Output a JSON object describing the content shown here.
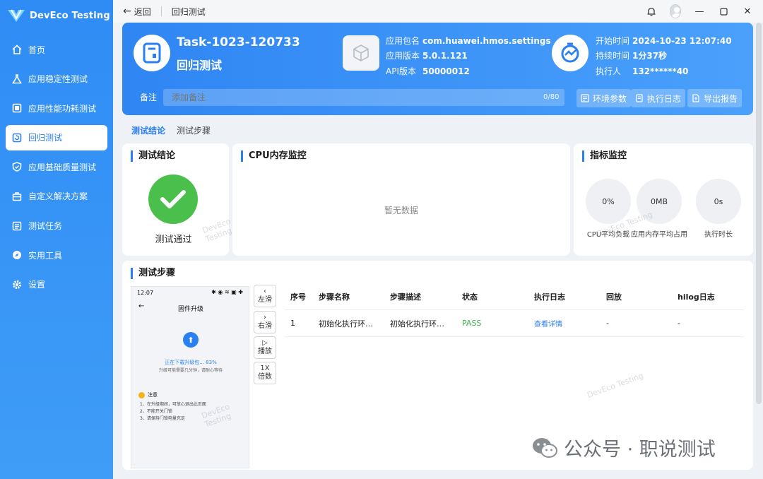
{
  "app": {
    "name": "DevEco Testing"
  },
  "colors": {
    "accent": "#2a7ff2",
    "sidebar": "#3592f6",
    "pass": "#3fb34f",
    "success_circle": "#4bbf4b"
  },
  "sidebar": {
    "items": [
      {
        "label": "首页",
        "icon": "home-icon"
      },
      {
        "label": "应用稳定性测试",
        "icon": "flask-icon"
      },
      {
        "label": "应用性能功耗测试",
        "icon": "performance-icon"
      },
      {
        "label": "回归测试",
        "icon": "regression-icon",
        "active": true
      },
      {
        "label": "应用基础质量测试",
        "icon": "shield-check-icon"
      },
      {
        "label": "自定义解决方案",
        "icon": "toolbox-icon"
      },
      {
        "label": "测试任务",
        "icon": "list-icon"
      },
      {
        "label": "实用工具",
        "icon": "compass-icon"
      },
      {
        "label": "设置",
        "icon": "gear-icon"
      }
    ]
  },
  "topbar": {
    "back_label": "返回",
    "breadcrumb": "回归测试"
  },
  "task": {
    "id": "Task-1023-120733",
    "type": "回归测试",
    "package_label": "应用包名",
    "package": "com.huawei.hmos.settings",
    "version_label": "应用版本",
    "version": "5.0.1.121",
    "api_label": "API版本",
    "api": "50000012",
    "start_label": "开始时间",
    "start": "2024-10-23 12:07:40",
    "duration_label": "持续时间",
    "duration": "1分37秒",
    "executor_label": "执行人",
    "executor": "132******40",
    "remark_label": "备注",
    "remark_placeholder": "添加备注",
    "remark_count": "0/80"
  },
  "header_buttons": {
    "env": "环境参数",
    "log": "执行日志",
    "export": "导出报告"
  },
  "tabs": [
    {
      "label": "测试结论",
      "active": true
    },
    {
      "label": "测试步骤"
    }
  ],
  "result": {
    "title": "测试结论",
    "text": "测试通过"
  },
  "cpu": {
    "title": "CPU内存监控",
    "empty": "暂无数据"
  },
  "metrics": {
    "title": "指标监控",
    "items": [
      {
        "value": "0%",
        "label": "CPU平均负载"
      },
      {
        "value": "0MB",
        "label": "应用内存平均占用"
      },
      {
        "value": "0s",
        "label": "执行时长"
      }
    ]
  },
  "steps": {
    "title": "测试步骤",
    "phone": {
      "time": "12:07",
      "title": "固件升级",
      "progress": "正在下载升级包... 83%",
      "sub": "升级可能需要几分钟，请耐心等待",
      "note": "注意",
      "list": [
        "1、在升级期间，可放心退出此页面",
        "2、不能开关门锁",
        "3、请保持门锁电量充足"
      ]
    },
    "controls": [
      {
        "icon": "‹",
        "label": "左滑"
      },
      {
        "icon": "›",
        "label": "右滑"
      },
      {
        "icon": "▷",
        "label": "播放"
      },
      {
        "icon": "1X",
        "label": "倍数"
      }
    ],
    "columns": [
      "序号",
      "步骤名称",
      "步骤描述",
      "状态",
      "执行日志",
      "回放",
      "hilog日志"
    ],
    "rows": [
      {
        "no": "1",
        "name": "初始化执行环…",
        "desc": "初始化执行环…",
        "status": "PASS",
        "log": "查看详情",
        "replay": "-",
        "hilog": "-"
      }
    ]
  },
  "watermark": "DevEco Testing",
  "footer": {
    "wechat": "公众号 · 职说测试"
  }
}
